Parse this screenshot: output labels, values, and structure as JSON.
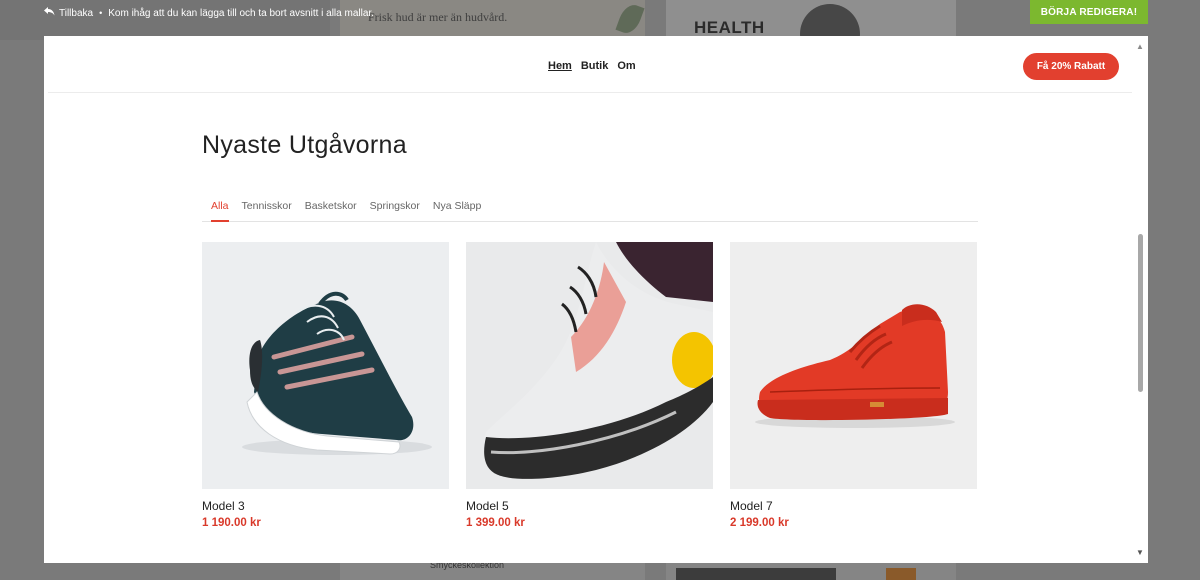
{
  "editor": {
    "back_label": "Tillbaka",
    "separator": "•",
    "reminder": "Kom ihåg att du kan lägga till och ta bort avsnitt i alla mallar.",
    "start_button": "BÖRJA REDIGERA!"
  },
  "background": {
    "promo_text": "Frisk hud är mer än hudvård.",
    "health_text": "HEALTH",
    "jewelry_text": "Smyckeskollektion"
  },
  "site": {
    "nav": [
      {
        "label": "Hem",
        "active": true
      },
      {
        "label": "Butik",
        "active": false
      },
      {
        "label": "Om",
        "active": false
      }
    ],
    "promo_button": "Få 20% Rabatt"
  },
  "section": {
    "title": "Nyaste Utgåvorna",
    "tabs": [
      {
        "label": "Alla",
        "active": true
      },
      {
        "label": "Tennisskor",
        "active": false
      },
      {
        "label": "Basketskor",
        "active": false
      },
      {
        "label": "Springskor",
        "active": false
      },
      {
        "label": "Nya Släpp",
        "active": false
      }
    ]
  },
  "products": [
    {
      "name": "Model 3",
      "price": "1 190.00 kr",
      "image": "dark-green-sneaker"
    },
    {
      "name": "Model 5",
      "price": "1 399.00 kr",
      "image": "white-running-shoe"
    },
    {
      "name": "Model 7",
      "price": "2 199.00 kr",
      "image": "red-high-top-sneaker"
    }
  ],
  "colors": {
    "accent": "#e2402f",
    "start_button": "#7cb82f"
  }
}
